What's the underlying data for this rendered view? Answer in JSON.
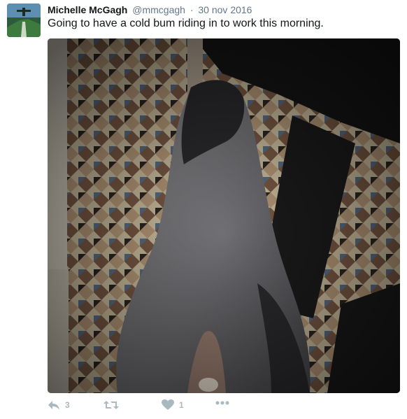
{
  "tweet": {
    "display_name": "Michelle McGagh",
    "handle": "@mmcgagh",
    "separator": "·",
    "date": "30 nov 2016",
    "text": "Going to have a cold bum riding in to work this morning."
  },
  "actions": {
    "reply_count": "3",
    "like_count": "1"
  },
  "icons": {
    "reply": "reply-icon",
    "retweet": "retweet-icon",
    "like": "heart-icon",
    "more": "more-icon"
  },
  "colors": {
    "icon_gray": "#aab8c2",
    "text": "#14171a",
    "secondary": "#657786"
  }
}
